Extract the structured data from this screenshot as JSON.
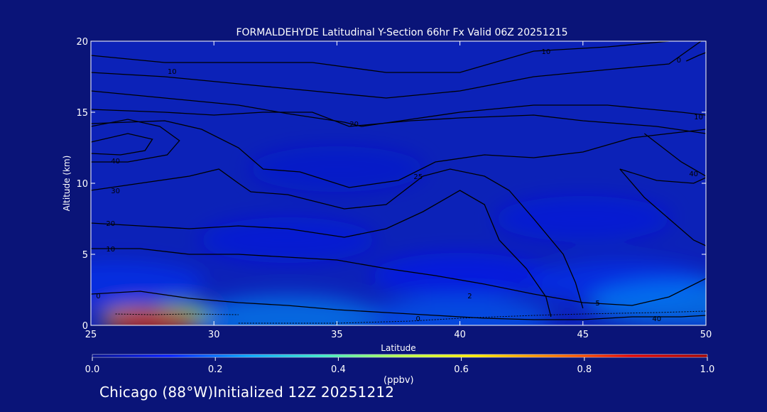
{
  "colors": {
    "background": "#0a1478",
    "plot_background": "#0c22b8",
    "contour_line": "#000000",
    "axis": "#ffffff"
  },
  "colorbar": {
    "ticks": [
      "0.0",
      "0.2",
      "0.4",
      "0.6",
      "0.8",
      "1.0"
    ],
    "range": [
      0,
      1
    ],
    "unit": "(ppbv)",
    "colormap": [
      "#000a8c",
      "#0019ff",
      "#00a0ff",
      "#38e8c8",
      "#b4ff4c",
      "#ffe600",
      "#ff7800",
      "#e00000",
      "#a00000"
    ]
  },
  "footer": {
    "text": "Chicago (88°W)Initialized 12Z 20251212"
  },
  "chart_data": {
    "type": "heatmap",
    "title": "FORMALDEHYDE Latitudinal Y-Section 66hr  Fx Valid 06Z 20251215",
    "xlabel": "Latitude",
    "ylabel": "Altitude (km)",
    "xlim": [
      25,
      50
    ],
    "ylim": [
      0,
      20
    ],
    "xticks": [
      "25",
      "30",
      "35",
      "40",
      "45",
      "50"
    ],
    "yticks": [
      "0",
      "5",
      "10",
      "15",
      "20"
    ],
    "value_unit": "ppbv",
    "color_range": [
      0,
      1
    ],
    "fields": [
      {
        "lat": 27.5,
        "alt": 0.3,
        "value": 0.95
      },
      {
        "lat": 27.0,
        "alt": 0.5,
        "value": 0.65
      },
      {
        "lat": 28.5,
        "alt": 0.7,
        "value": 0.45
      },
      {
        "lat": 33.0,
        "alt": 0.5,
        "value": 0.25
      },
      {
        "lat": 40.0,
        "alt": 0.5,
        "value": 0.2
      },
      {
        "lat": 49.0,
        "alt": 1.6,
        "value": 0.25
      },
      {
        "lat": 46.5,
        "alt": 3.0,
        "value": 0.15
      },
      {
        "lat": 26.0,
        "alt": 3.0,
        "value": 0.15
      },
      {
        "lat": 40.0,
        "alt": 3.5,
        "value": 0.12
      },
      {
        "lat": 33.0,
        "alt": 6.0,
        "value": 0.1
      },
      {
        "lat": 45.0,
        "alt": 7.5,
        "value": 0.1
      },
      {
        "lat": 35.0,
        "alt": 11.0,
        "value": 0.08
      }
    ],
    "contour_labels": [
      {
        "text": "10",
        "lat": 28.3,
        "alt": 17.9
      },
      {
        "text": "10",
        "lat": 43.5,
        "alt": 19.3
      },
      {
        "text": "0",
        "lat": 48.9,
        "alt": 18.7
      },
      {
        "text": "20",
        "lat": 35.7,
        "alt": 14.2
      },
      {
        "text": "10",
        "lat": 49.7,
        "alt": 14.7
      },
      {
        "text": "40",
        "lat": 26.0,
        "alt": 11.6
      },
      {
        "text": "30",
        "lat": 26.0,
        "alt": 9.5
      },
      {
        "text": "20",
        "lat": 25.8,
        "alt": 7.2
      },
      {
        "text": "10",
        "lat": 25.8,
        "alt": 5.4
      },
      {
        "text": "25",
        "lat": 38.3,
        "alt": 10.5
      },
      {
        "text": "40",
        "lat": 49.5,
        "alt": 10.7
      },
      {
        "text": "0",
        "lat": 25.3,
        "alt": 2.1
      },
      {
        "text": "2",
        "lat": 40.4,
        "alt": 2.1
      },
      {
        "text": "0",
        "lat": 38.3,
        "alt": 0.5
      },
      {
        "text": "5",
        "lat": 45.6,
        "alt": 1.6
      },
      {
        "text": "40",
        "lat": 48.0,
        "alt": 0.5
      }
    ],
    "contour_lines": [
      [
        [
          25,
          19.0
        ],
        [
          28,
          18.5
        ],
        [
          31,
          18.5
        ],
        [
          34,
          18.5
        ],
        [
          37,
          17.8
        ],
        [
          40,
          17.8
        ],
        [
          43,
          19.3
        ],
        [
          46,
          19.6
        ],
        [
          48.5,
          20.0
        ]
      ],
      [
        [
          25,
          17.8
        ],
        [
          28,
          17.5
        ],
        [
          31,
          17.0
        ],
        [
          34,
          16.5
        ],
        [
          37,
          16.0
        ],
        [
          40,
          16.5
        ],
        [
          43,
          17.5
        ],
        [
          46,
          18.0
        ],
        [
          48.5,
          18.4
        ],
        [
          49.8,
          20.0
        ]
      ],
      [
        [
          25,
          16.5
        ],
        [
          28,
          16.0
        ],
        [
          31,
          15.5
        ],
        [
          33,
          14.9
        ],
        [
          35.3,
          14.3
        ],
        [
          36,
          14.0
        ],
        [
          38,
          14.5
        ],
        [
          40,
          15.0
        ],
        [
          43,
          15.5
        ],
        [
          46,
          15.5
        ],
        [
          49,
          15.0
        ],
        [
          50,
          14.8
        ]
      ],
      [
        [
          25,
          15.2
        ],
        [
          28,
          15.0
        ],
        [
          30,
          14.8
        ],
        [
          32,
          15.0
        ],
        [
          34,
          15.0
        ],
        [
          35.5,
          14.0
        ],
        [
          38,
          14.4
        ],
        [
          40,
          14.6
        ],
        [
          43,
          14.8
        ],
        [
          45,
          14.4
        ],
        [
          48,
          14.0
        ],
        [
          50,
          13.5
        ]
      ],
      [
        [
          25,
          14.2
        ],
        [
          28,
          14.4
        ],
        [
          29.5,
          13.8
        ],
        [
          31,
          12.5
        ],
        [
          32,
          11.0
        ],
        [
          33.5,
          10.8
        ],
        [
          35.5,
          9.7
        ],
        [
          37.5,
          10.2
        ],
        [
          39,
          11.5
        ],
        [
          41,
          12.0
        ],
        [
          43,
          11.8
        ],
        [
          45,
          12.2
        ],
        [
          47,
          13.2
        ],
        [
          50,
          13.8
        ]
      ],
      [
        [
          25,
          14.0
        ],
        [
          26.5,
          14.5
        ],
        [
          27.8,
          14.0
        ],
        [
          28.6,
          13.0
        ],
        [
          28.1,
          12.0
        ],
        [
          26.5,
          11.5
        ],
        [
          25,
          11.5
        ]
      ],
      [
        [
          25,
          12.9
        ],
        [
          26.5,
          13.5
        ],
        [
          27.5,
          13.1
        ],
        [
          27.2,
          12.3
        ],
        [
          26.2,
          12.0
        ],
        [
          25,
          12.1
        ]
      ],
      [
        [
          25,
          9.5
        ],
        [
          27,
          10.0
        ],
        [
          29,
          10.5
        ],
        [
          30.2,
          11.0
        ],
        [
          31,
          10.0
        ],
        [
          31.5,
          9.4
        ],
        [
          33,
          9.2
        ],
        [
          35.3,
          8.2
        ],
        [
          37,
          8.5
        ],
        [
          38.5,
          10.5
        ],
        [
          39.6,
          11.0
        ],
        [
          41,
          10.5
        ],
        [
          42,
          9.5
        ],
        [
          43,
          7.5
        ],
        [
          44.2,
          5.0
        ],
        [
          44.7,
          3.0
        ],
        [
          45,
          1.2
        ]
      ],
      [
        [
          25,
          7.2
        ],
        [
          27,
          7.0
        ],
        [
          29,
          6.8
        ],
        [
          31,
          7.0
        ],
        [
          33,
          6.8
        ],
        [
          35.3,
          6.2
        ],
        [
          37,
          6.8
        ],
        [
          38.5,
          8.0
        ],
        [
          40,
          9.5
        ],
        [
          41,
          8.5
        ],
        [
          41.6,
          6.0
        ],
        [
          42.7,
          4.0
        ],
        [
          43.5,
          2.0
        ],
        [
          43.7,
          0.6
        ]
      ],
      [
        [
          25,
          5.4
        ],
        [
          27,
          5.4
        ],
        [
          29,
          5.0
        ],
        [
          31,
          5.0
        ],
        [
          33,
          4.8
        ],
        [
          35,
          4.6
        ],
        [
          37,
          4.0
        ],
        [
          39,
          3.5
        ],
        [
          41,
          2.9
        ],
        [
          43,
          2.2
        ],
        [
          45,
          1.6
        ],
        [
          47,
          1.4
        ],
        [
          48.5,
          2.0
        ],
        [
          50,
          3.3
        ]
      ],
      [
        [
          49.2,
          18.6
        ],
        [
          49.7,
          19.0
        ],
        [
          50,
          19.2
        ]
      ],
      [
        [
          47.5,
          13.5
        ],
        [
          49,
          11.5
        ],
        [
          50,
          10.5
        ]
      ],
      [
        [
          46.5,
          11.0
        ],
        [
          48,
          10.2
        ],
        [
          49.5,
          10.0
        ],
        [
          50,
          10.4
        ]
      ],
      [
        [
          46.5,
          11.0
        ],
        [
          47.5,
          9.0
        ],
        [
          48.5,
          7.5
        ],
        [
          49.5,
          6.0
        ],
        [
          50,
          5.6
        ]
      ],
      [
        [
          25,
          2.2
        ],
        [
          27,
          2.4
        ],
        [
          29,
          1.9
        ],
        [
          31,
          1.6
        ],
        [
          33,
          1.4
        ],
        [
          35,
          1.1
        ],
        [
          37,
          0.9
        ],
        [
          39,
          0.7
        ],
        [
          41,
          0.5
        ],
        [
          43,
          0.4
        ],
        [
          45,
          0.4
        ],
        [
          47,
          0.6
        ],
        [
          49,
          0.6
        ],
        [
          50,
          0.7
        ]
      ]
    ],
    "dotted_lines": [
      [
        [
          26.0,
          0.8
        ],
        [
          27.5,
          0.75
        ],
        [
          29,
          0.8
        ],
        [
          31,
          0.75
        ]
      ],
      [
        [
          31,
          0.15
        ],
        [
          35,
          0.15
        ],
        [
          38,
          0.3
        ],
        [
          40,
          0.5
        ],
        [
          43,
          0.7
        ],
        [
          45,
          0.8
        ],
        [
          48,
          0.9
        ],
        [
          50,
          1.0
        ]
      ]
    ]
  }
}
